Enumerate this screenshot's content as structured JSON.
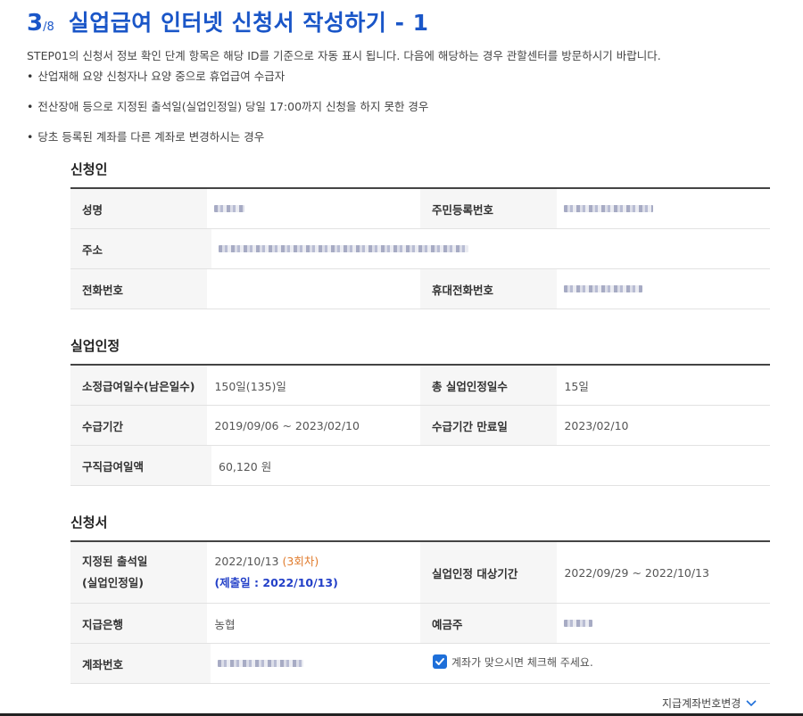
{
  "header": {
    "step": "3",
    "total": "/8",
    "title": "실업급여 인터넷 신청서 작성하기 - 1"
  },
  "intro": "STEP01의 신청서 정보 확인 단계 항목은 해당 ID를 기준으로 자동 표시 됩니다. 다음에 해당하는 경우 관할센터를 방문하시기 바랍니다.",
  "bullets": [
    "산업재해 요양 신청자나 요양 중으로 휴업급여 수급자",
    "전산장애 등으로 지정된 출석일(실업인정일) 당일 17:00까지 신청을 하지 못한 경우",
    "당초 등록된 계좌를 다른 계좌로 변경하시는 경우"
  ],
  "applicant": {
    "title": "신청인",
    "name_label": "성명",
    "rrn_label": "주민등록번호",
    "address_label": "주소",
    "phone_label": "전화번호",
    "mobile_label": "휴대전화번호"
  },
  "unemployment": {
    "title": "실업인정",
    "days_label": "소정급여일수(남은일수)",
    "days_value": "150일(135)일",
    "total_label": "총 실업인정일수",
    "total_value": "15일",
    "period_label": "수급기간",
    "period_value": "2019/09/06 ~ 2023/02/10",
    "expiry_label": "수급기간 만료일",
    "expiry_value": "2023/02/10",
    "daily_label": "구직급여일액",
    "daily_value": "60,120 원"
  },
  "application": {
    "title": "신청서",
    "date_label_1": "지정된 출석일",
    "date_label_2": "(실업인정일)",
    "date_value": "2022/10/13",
    "round": "(3회차)",
    "submit": "(제출일 : 2022/10/13)",
    "target_label": "실업인정 대상기간",
    "target_value": "2022/09/29  ~  2022/10/13",
    "bank_label": "지급은행",
    "bank_value": "농협",
    "holder_label": "예금주",
    "account_label": "계좌번호",
    "confirm_text": "계좌가 맞으시면 체크해 주세요.",
    "confirm_checked": true,
    "change_link": "지급계좌번호변경"
  },
  "colors": {
    "accent": "#1a56c8",
    "checkbox": "#1e6fd9",
    "round": "#e07b2c",
    "submit": "#2340c8"
  }
}
